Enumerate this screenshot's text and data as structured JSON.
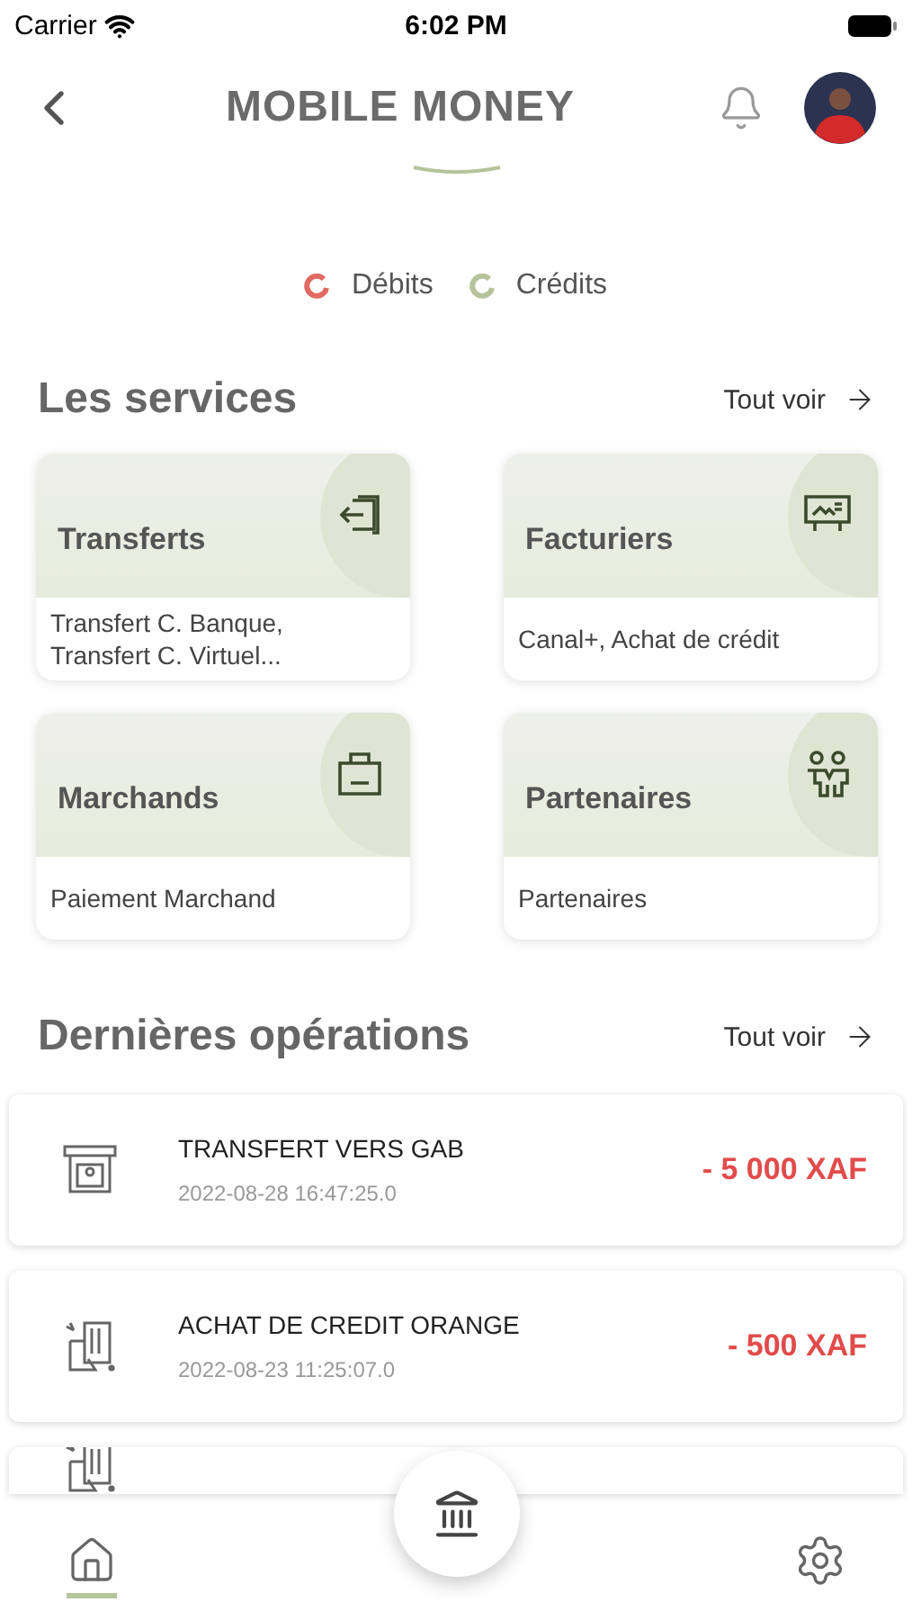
{
  "status_bar": {
    "carrier": "Carrier",
    "time": "6:02 PM"
  },
  "header": {
    "title": "MOBILE MONEY"
  },
  "legend": [
    {
      "label": "Débits",
      "color": "#e06a63"
    },
    {
      "label": "Crédits",
      "color": "#b5c49a"
    }
  ],
  "services": {
    "title": "Les services",
    "see_all": "Tout voir",
    "items": [
      {
        "kind": "transfer",
        "title": "Transferts",
        "description": "Transfert C. Banque, Transfert C. Virtuel..."
      },
      {
        "kind": "billers",
        "title": "Facturiers",
        "description": "Canal+, Achat de crédit"
      },
      {
        "kind": "merchants",
        "title": "Marchands",
        "description": "Paiement Marchand"
      },
      {
        "kind": "partners",
        "title": "Partenaires",
        "description": "Partenaires"
      }
    ]
  },
  "operations": {
    "title": "Dernières opérations",
    "see_all": "Tout voir",
    "items": [
      {
        "kind": "atm",
        "label": "TRANSFERT VERS GAB",
        "date": "2022-08-28 16:47:25.0",
        "amount": "- 5 000 XAF"
      },
      {
        "kind": "airtime",
        "label": "ACHAT DE CREDIT ORANGE",
        "date": "2022-08-23 11:25:07.0",
        "amount": "- 500 XAF"
      },
      {
        "kind": "airtime"
      }
    ]
  },
  "bottom_nav": [
    {
      "kind": "home",
      "selected": true
    },
    {
      "kind": "bank",
      "selected": false
    },
    {
      "kind": "settings",
      "selected": false
    }
  ]
}
